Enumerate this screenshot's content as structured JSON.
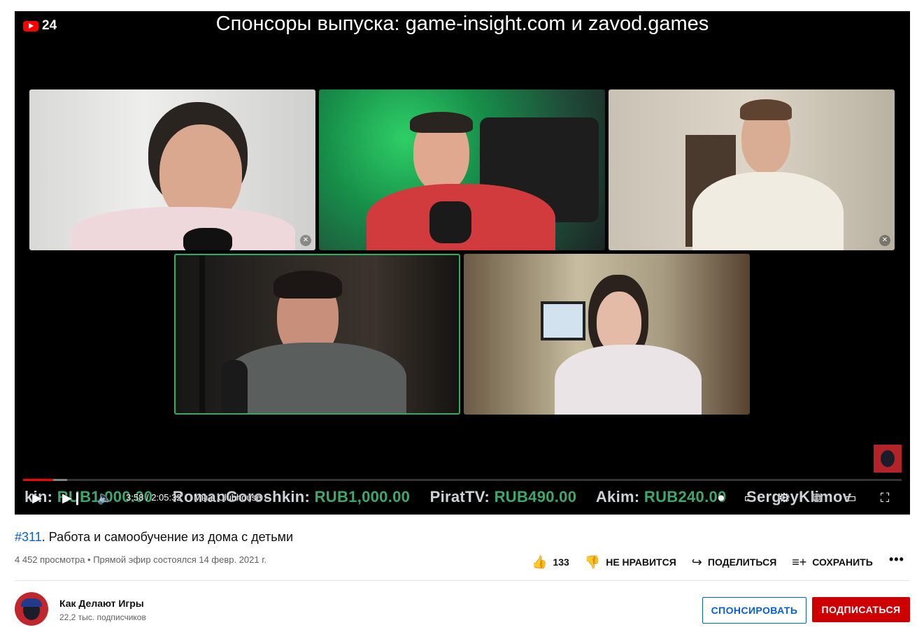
{
  "player": {
    "brand_number": "24",
    "banner": "Спонсоры выпуска: game-insight.com и zavod.games",
    "progress": {
      "played_fraction": 0.034,
      "loaded_fraction": 0.05
    },
    "ticker": [
      {
        "name": "kin:",
        "amount": "RUB1,000.00"
      },
      {
        "name": "RomanGoroshkin:",
        "amount": "RUB1,000.00"
      },
      {
        "name": "PiratTV:",
        "amount": "RUB490.00"
      },
      {
        "name": "Akim:",
        "amount": "RUB240.00"
      },
      {
        "name": "SergeyKlimov",
        "amount": ""
      }
    ],
    "time_current": "3:58",
    "time_separator": "/",
    "time_total": "2:05:32",
    "chapter": "Мы в Clubhouse",
    "chapter_chevron": "›"
  },
  "video": {
    "hashtag": "#311",
    "title_rest": ". Работа и самообучение из дома с детьми",
    "meta": "4 452 просмотра • Прямой эфир состоялся 14 февр. 2021 г."
  },
  "actions": {
    "like_count": "133",
    "dislike_label": "НЕ НРАВИТСЯ",
    "share_label": "ПОДЕЛИТЬСЯ",
    "save_label": "СОХРАНИТЬ",
    "more_label": "•••"
  },
  "channel": {
    "name": "Как Делают Игры",
    "subscribers": "22,2 тыс. подписчиков",
    "sponsor_label": "СПОНСИРОВАТЬ",
    "subscribe_label": "ПОДПИСАТЬСЯ"
  },
  "colors": {
    "accent_red": "#ff0000",
    "subscribe_red": "#cc0000",
    "link_blue": "#065fd4",
    "ticker_amount_green": "#3ea86a",
    "active_speaker_border": "#2eaf5f"
  },
  "icons": [
    "youtube-logo-icon",
    "play-icon",
    "next-icon",
    "volume-icon",
    "chevron-right-icon",
    "autoplay-toggle-icon",
    "subtitles-icon",
    "settings-icon",
    "miniplayer-icon",
    "theater-icon",
    "fullscreen-icon",
    "mic-off-icon",
    "like-icon",
    "dislike-icon",
    "share-icon",
    "save-playlist-icon",
    "more-icon"
  ]
}
